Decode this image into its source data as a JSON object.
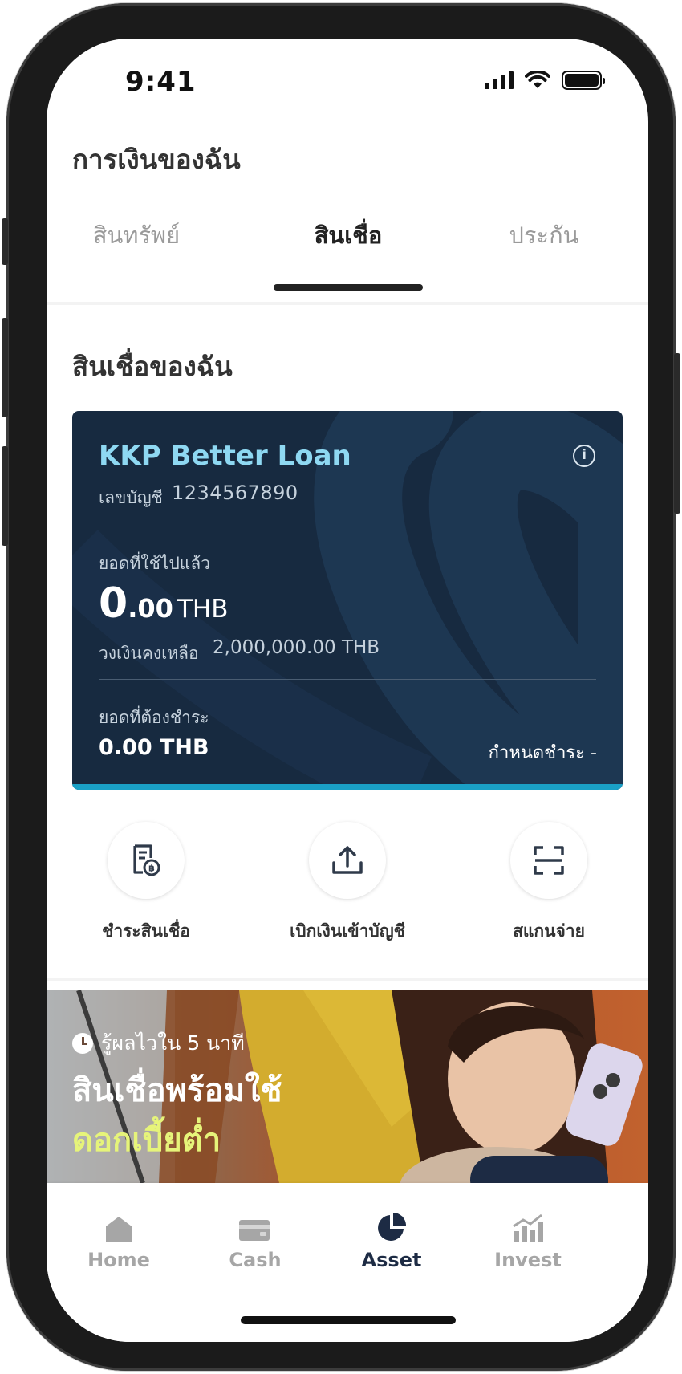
{
  "status_bar": {
    "time": "9:41"
  },
  "header": {
    "title": "การเงินของฉัน"
  },
  "tabs": [
    {
      "label": "สินทรัพย์",
      "active": false
    },
    {
      "label": "สินเชื่อ",
      "active": true
    },
    {
      "label": "ประกัน",
      "active": false
    }
  ],
  "section": {
    "title": "สินเชื่อของฉัน"
  },
  "loan_card": {
    "name": "KKP Better Loan",
    "account_label": "เลขบัญชี",
    "account_number": "1234567890",
    "used_label": "ยอดที่ใช้ไปแล้ว",
    "used_int": "0",
    "used_dec": ".00",
    "used_currency": "THB",
    "limit_label": "วงเงินคงเหลือ",
    "limit_value": "2,000,000.00 THB",
    "due_label": "ยอดที่ต้องชำระ",
    "due_value": "0.00 THB",
    "due_date": "กำหนดชำระ -",
    "colors": {
      "card_bg": "#172a40",
      "title": "#8ed8f2",
      "accent_bar": "#1aa0c6"
    }
  },
  "actions": [
    {
      "label": "ชำระสินเชื่อ",
      "icon": "bill-pay-icon"
    },
    {
      "label": "เบิกเงินเข้าบัญชี",
      "icon": "upload-icon"
    },
    {
      "label": "สแกนจ่าย",
      "icon": "scan-icon"
    }
  ],
  "banner": {
    "subtitle": "รู้ผลไวใน 5 นาที",
    "title_line1": "สินเชื่อพร้อมใช้",
    "title_line2": "ดอกเบี้ยต่ำ"
  },
  "bottom_nav": [
    {
      "label": "Home",
      "icon": "home-icon",
      "active": false
    },
    {
      "label": "Cash",
      "icon": "cash-icon",
      "active": false
    },
    {
      "label": "Asset",
      "icon": "pie-chart-icon",
      "active": true
    },
    {
      "label": "Invest",
      "icon": "invest-chart-icon",
      "active": false
    }
  ]
}
